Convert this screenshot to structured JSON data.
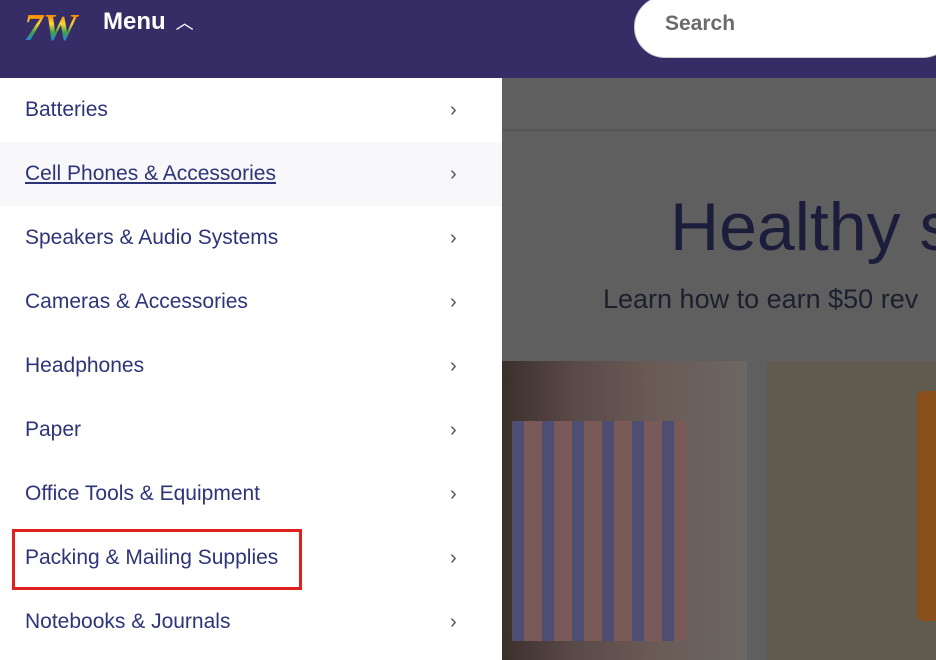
{
  "header": {
    "menu_label": "Menu",
    "search_placeholder": "Search",
    "brand_colors": {
      "header_bg": "#372d66",
      "link": "#2d3478",
      "highlight": "#e0201c"
    }
  },
  "menu": {
    "items": [
      {
        "label": "Batteries",
        "active": false
      },
      {
        "label": "Cell Phones & Accessories",
        "active": true
      },
      {
        "label": "Speakers & Audio Systems",
        "active": false
      },
      {
        "label": "Cameras & Accessories",
        "active": false
      },
      {
        "label": "Headphones",
        "active": false
      },
      {
        "label": "Paper",
        "active": false
      },
      {
        "label": "Office Tools & Equipment",
        "active": false
      },
      {
        "label": "Packing & Mailing Supplies",
        "active": false,
        "highlighted": true
      },
      {
        "label": "Notebooks & Journals",
        "active": false
      }
    ]
  },
  "background": {
    "headline": "Healthy s",
    "subtitle": "Learn how to earn $50 rev"
  }
}
